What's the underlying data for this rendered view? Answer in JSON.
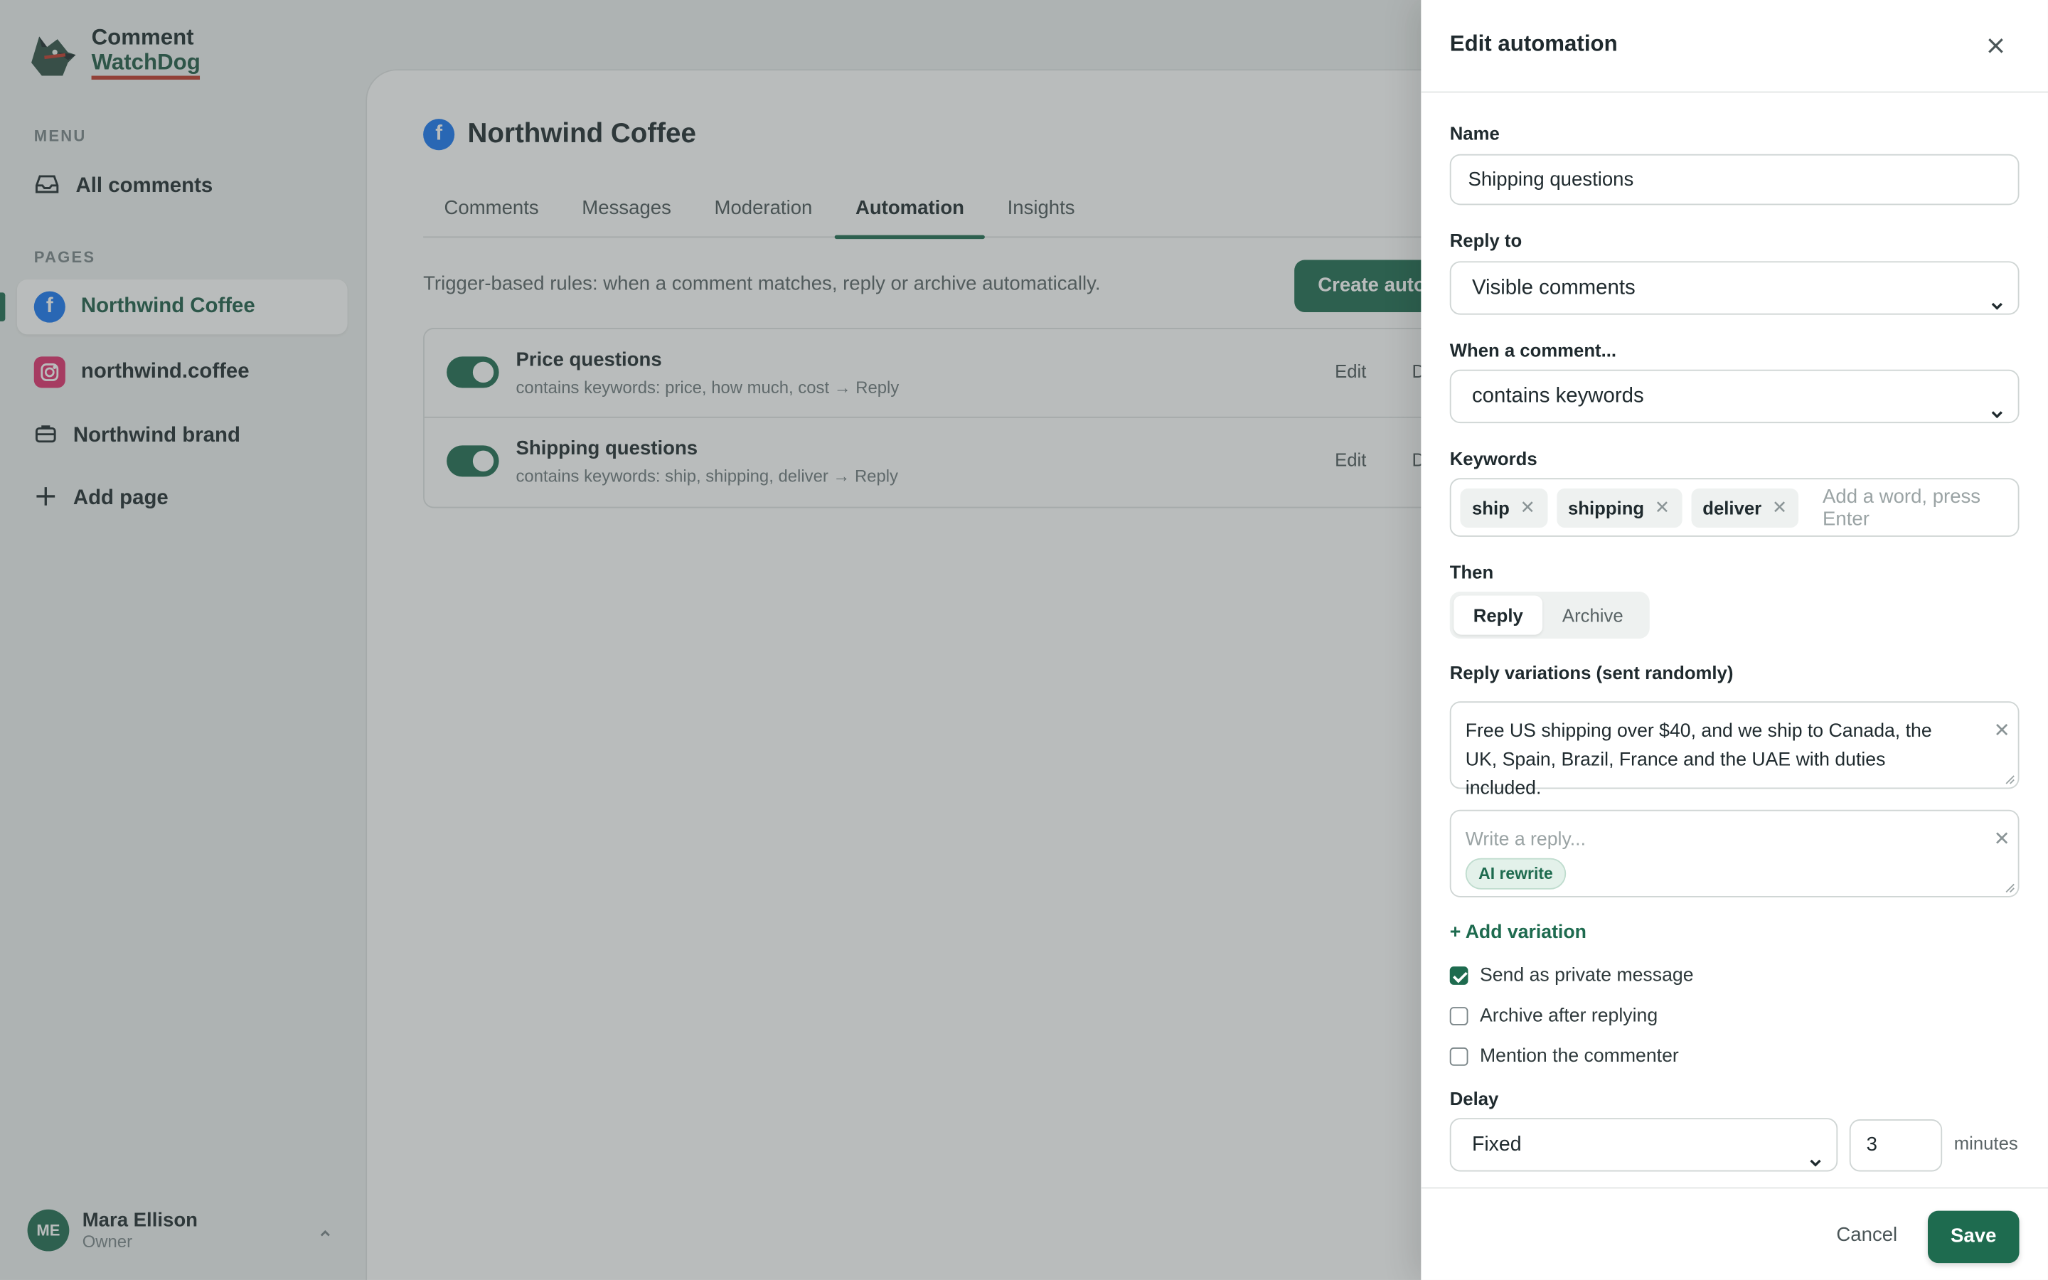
{
  "app": {
    "logo_line1": "Comment",
    "logo_line2": "WatchDog"
  },
  "sidebar": {
    "menu_label": "MENU",
    "all_comments": "All comments",
    "pages_label": "PAGES",
    "pages": [
      {
        "label": "Northwind Coffee",
        "icon": "facebook-icon",
        "active": true
      },
      {
        "label": "northwind.coffee",
        "icon": "instagram-icon",
        "active": false
      },
      {
        "label": "Northwind brand",
        "icon": "briefcase-icon",
        "active": false
      }
    ],
    "add_page": "Add page",
    "user": {
      "initials": "ME",
      "name": "Mara Ellison",
      "role": "Owner"
    }
  },
  "main": {
    "title": "Northwind Coffee",
    "tabs": [
      "Comments",
      "Messages",
      "Moderation",
      "Automation",
      "Insights"
    ],
    "active_tab": "Automation",
    "intro": "Trigger-based rules: when a comment matches, reply or archive automatically.",
    "create_button": "Create automation",
    "rules": [
      {
        "title": "Price questions",
        "desc": "contains keywords: price, how much, cost → Reply",
        "enabled": true,
        "edit": "Edit",
        "delete": "Delete"
      },
      {
        "title": "Shipping questions",
        "desc": "contains keywords: ship, shipping, deliver → Reply",
        "enabled": true,
        "edit": "Edit",
        "delete": "Delete"
      }
    ]
  },
  "drawer": {
    "title": "Edit automation",
    "name_label": "Name",
    "name_value": "Shipping questions",
    "reply_to_label": "Reply to",
    "reply_to_value": "Visible comments",
    "when_label": "When a comment...",
    "when_value": "contains keywords",
    "keywords_label": "Keywords",
    "keywords": [
      "ship",
      "shipping",
      "deliver"
    ],
    "keywords_placeholder": "Add a word, press Enter",
    "then_label": "Then",
    "then_options": [
      "Reply",
      "Archive"
    ],
    "then_selected": "Reply",
    "variations_label": "Reply variations (sent randomly)",
    "variation_1": "Free US shipping over $40, and we ship to Canada, the UK, Spain, Brazil, France and the UAE with duties included.",
    "variation_2_placeholder": "Write a reply...",
    "ai_rewrite": "AI rewrite",
    "add_variation": "+ Add variation",
    "options": [
      {
        "label": "Send as private message",
        "checked": true
      },
      {
        "label": "Archive after replying",
        "checked": false
      },
      {
        "label": "Mention the commenter",
        "checked": false
      }
    ],
    "delay_label": "Delay",
    "delay_mode": "Fixed",
    "delay_value": "3",
    "delay_unit": "minutes",
    "cancel": "Cancel",
    "save": "Save"
  },
  "colors": {
    "accent": "#1e6b4f",
    "facebook": "#1877f2",
    "instagram": "#e1306c",
    "logo_underline": "#c0392b"
  }
}
